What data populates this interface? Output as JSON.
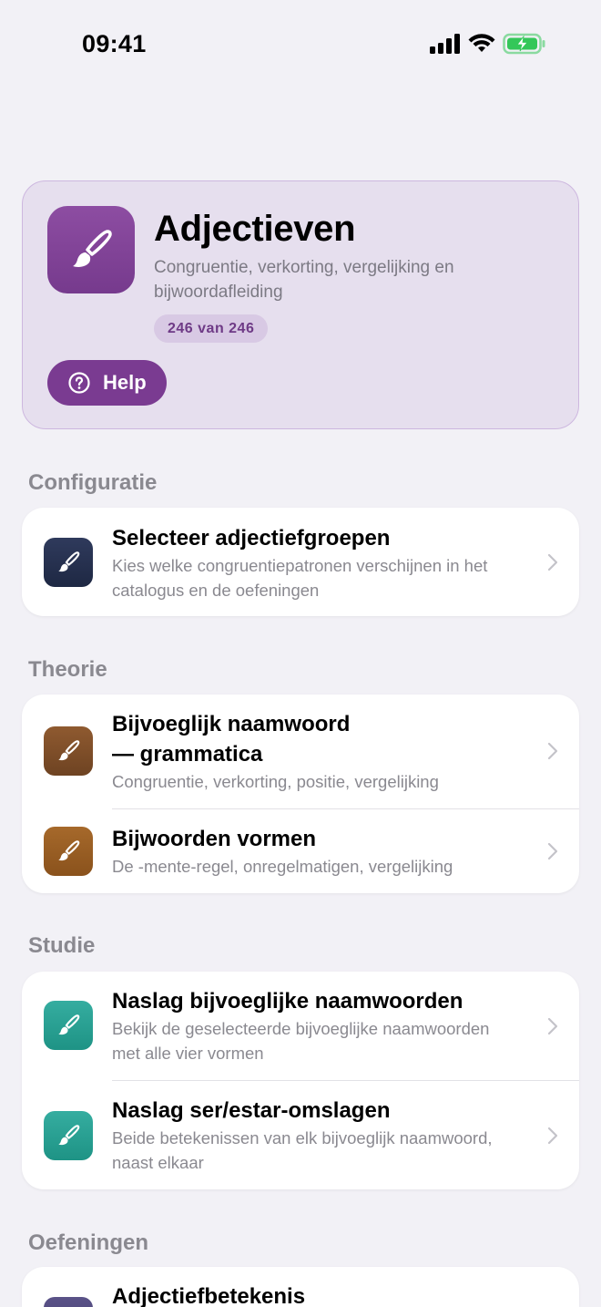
{
  "status_bar": {
    "time": "09:41"
  },
  "hero": {
    "title": "Adjectieven",
    "subtitle": "Congruentie, verkorting, vergelijking en bijwoordafleiding",
    "badge": "246 van 246",
    "help_label": "Help",
    "icon": "paintbrush-icon",
    "accent_color": "#7A3B91"
  },
  "sections": {
    "configuratie": {
      "header": "Configuratie",
      "items": [
        {
          "title": "Selecteer adjectiefgroepen",
          "subtitle": "Kies welke congruentiepatronen verschijnen in het catalogus en de oefeningen",
          "icon": "paintbrush-icon",
          "color": "#2F3A5C"
        }
      ]
    },
    "theorie": {
      "header": "Theorie",
      "items": [
        {
          "title_line1": "Bijvoeglijk naamwoord",
          "title_line2": "— grammatica",
          "subtitle": "Congruentie, verkorting, positie, vergelijking",
          "icon": "paintbrush-icon",
          "color": "#8F5A30"
        },
        {
          "title": "Bijwoorden vormen",
          "subtitle": "De -mente-regel, onregelmatigen, vergelijking",
          "icon": "paintbrush-icon",
          "color": "#A6692B"
        }
      ]
    },
    "studie": {
      "header": "Studie",
      "items": [
        {
          "title": "Naslag bijvoeglijke naamwoorden",
          "subtitle": "Bekijk de geselecteerde bijvoeglijke naamwoorden met alle vier vormen",
          "icon": "paintbrush-icon",
          "color": "#35ADA0"
        },
        {
          "title": "Naslag ser/estar-omslagen",
          "subtitle": "Beide betekenissen van elk bijvoeglijk naamwoord, naast elkaar",
          "icon": "paintbrush-icon",
          "color": "#35ADA0"
        }
      ]
    },
    "oefeningen": {
      "header": "Oefeningen",
      "items": [
        {
          "title": "Adjectiefbetekenis",
          "icon": "paintbrush-icon",
          "color": "#5A5288"
        }
      ]
    }
  }
}
